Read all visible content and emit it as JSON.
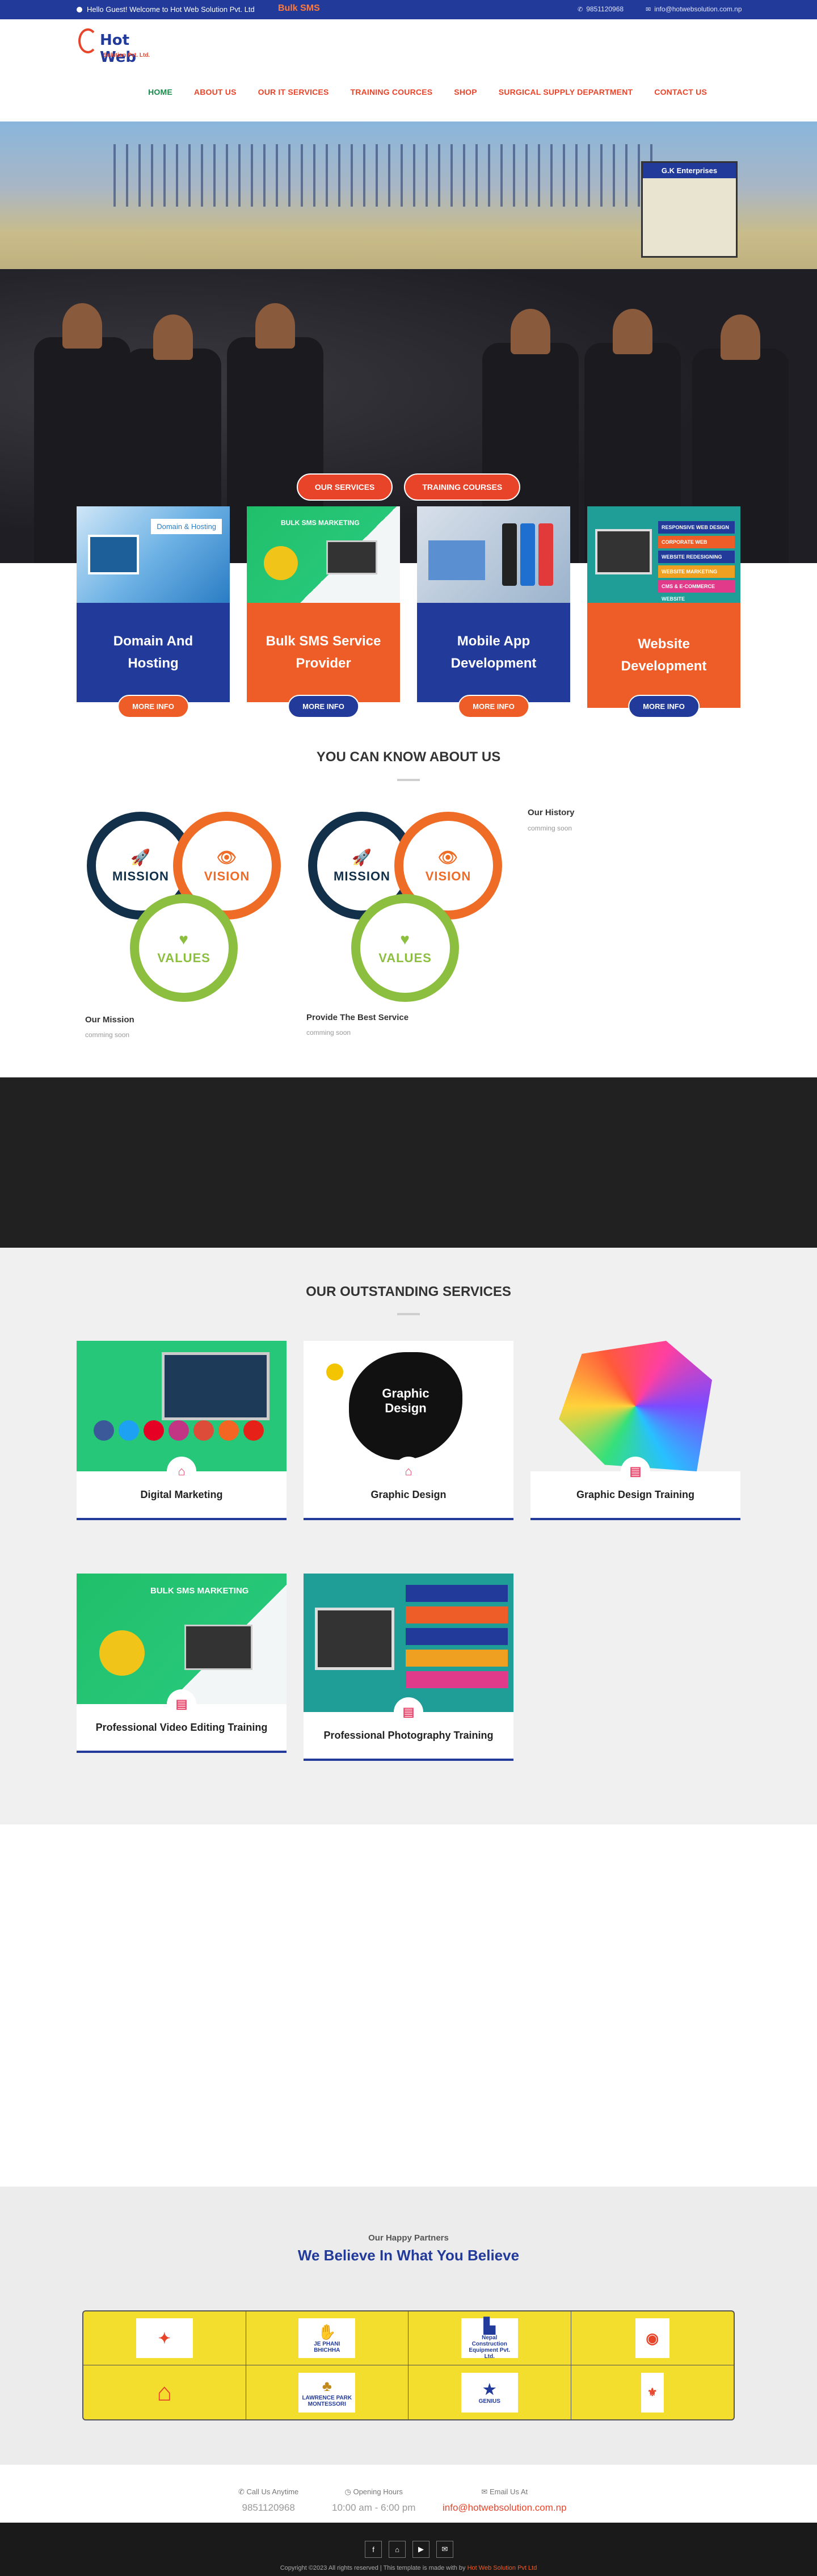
{
  "topbar": {
    "greeting": "Hello Guest! Welcome to Hot Web Solution Pvt. Ltd",
    "bulk_sms": "Bulk SMS",
    "phone": "9851120968",
    "email": "info@hotwebsolution.com.np"
  },
  "logo": {
    "name": "Hot Web",
    "tagline": "Solution Pvt. Ltd."
  },
  "nav": [
    "HOME",
    "ABOUT US",
    "OUR IT SERVICES",
    "TRAINING COURCES",
    "SHOP",
    "SURGICAL SUPPLY DEPARTMENT",
    "CONTACT US"
  ],
  "hero": {
    "btn_services": "OUR SERVICES",
    "btn_training": "TRAINING COURSES",
    "sign_text": "G.K Enterprises"
  },
  "cards": [
    {
      "title": "Domain And Hosting",
      "more": "MORE INFO",
      "color": "#223a9a",
      "img_text": "Domain & Hosting"
    },
    {
      "title": "Bulk SMS Service Provider",
      "more": "MORE INFO",
      "color": "#ee5c27",
      "img_text": "BULK SMS MARKETING"
    },
    {
      "title": "Mobile App Development",
      "more": "MORE INFO",
      "color": "#223a9a",
      "img_text": ""
    },
    {
      "title": "Website Development",
      "more": "MORE INFO",
      "color": "#ee5c27",
      "img_text": ""
    }
  ],
  "web_strips": [
    "RESPONSIVE WEB DESIGN",
    "CORPORATE WEB DESIGNING",
    "WEBSITE REDESIGNING",
    "WEBSITE MARKETING",
    "CMS & E-COMMERCE WEBSITE"
  ],
  "about": {
    "title": "YOU CAN KNOW ABOUT US",
    "mission": "MISSION",
    "vision": "VISION",
    "values": "VALUES",
    "history_title": "Our History",
    "history_text": "comming soon",
    "block1_title": "Our Mission",
    "block1_text": "comming soon",
    "block2_title": "Provide The Best Service",
    "block2_text": "comming soon"
  },
  "services": {
    "title": "OUR OUTSTANDING SERVICES",
    "items": [
      {
        "label": "Digital Marketing"
      },
      {
        "label": "Graphic Design",
        "pic_text": "Graphic Design"
      },
      {
        "label": "Graphic Design Training"
      },
      {
        "label": "Professional Video Editing Training",
        "pic_text": "BULK SMS MARKETING"
      },
      {
        "label": "Professional Photography Training"
      }
    ]
  },
  "partners": {
    "subtitle": "Our Happy Partners",
    "title": "We Believe In What You Believe",
    "logos": [
      "JE PHANI BHICHHA",
      "Nepal Construction Equipment Pvt. Ltd.",
      "LAWRENCE PARK MONTESSORI",
      "GENIUS"
    ]
  },
  "contacts": {
    "call_label": "Call Us Anytime",
    "call_value": "9851120968",
    "hours_label": "Opening Hours",
    "hours_value": "10:00 am - 6:00 pm",
    "email_label": "Email Us At",
    "email_value": "info@hotwebsolution.com.np"
  },
  "footer": {
    "copyright": "Copyright ©2023 All rights reserved | This template is made with by",
    "brand": "Hot Web Solution Pvt Ltd"
  },
  "colors": {
    "brand_blue": "#223a9a",
    "brand_orange": "#ee5c27",
    "nav_active": "#1a8a4a"
  }
}
